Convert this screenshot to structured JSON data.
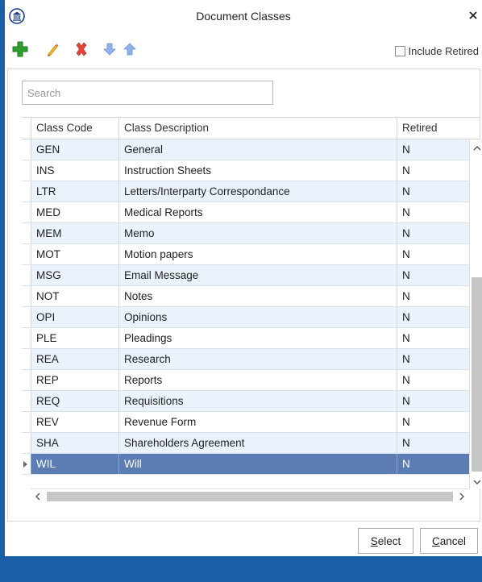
{
  "window": {
    "title": "Document Classes"
  },
  "toolbar": {
    "add_icon": "plus-icon",
    "edit_icon": "pencil-icon",
    "delete_icon": "x-icon",
    "down_icon": "arrow-down-icon",
    "up_icon": "arrow-up-icon",
    "include_retired_label": "Include Retired",
    "include_retired_checked": false
  },
  "search": {
    "placeholder": "Search",
    "value": ""
  },
  "grid": {
    "columns": [
      "Class Code",
      "Class Description",
      "Retired"
    ],
    "rows": [
      {
        "code": "GEN",
        "description": "General",
        "retired": "N"
      },
      {
        "code": "INS",
        "description": "Instruction Sheets",
        "retired": "N"
      },
      {
        "code": "LTR",
        "description": "Letters/Interparty Correspondance",
        "retired": "N"
      },
      {
        "code": "MED",
        "description": "Medical Reports",
        "retired": "N"
      },
      {
        "code": "MEM",
        "description": "Memo",
        "retired": "N"
      },
      {
        "code": "MOT",
        "description": "Motion papers",
        "retired": "N"
      },
      {
        "code": "MSG",
        "description": "Email Message",
        "retired": "N"
      },
      {
        "code": "NOT",
        "description": "Notes",
        "retired": "N"
      },
      {
        "code": "OPI",
        "description": "Opinions",
        "retired": "N"
      },
      {
        "code": "PLE",
        "description": "Pleadings",
        "retired": "N"
      },
      {
        "code": "REA",
        "description": "Research",
        "retired": "N"
      },
      {
        "code": "REP",
        "description": "Reports",
        "retired": "N"
      },
      {
        "code": "REQ",
        "description": "Requisitions",
        "retired": "N"
      },
      {
        "code": "REV",
        "description": "Revenue Form",
        "retired": "N"
      },
      {
        "code": "SHA",
        "description": "Shareholders Agreement",
        "retired": "N"
      },
      {
        "code": "WIL",
        "description": "Will",
        "retired": "N"
      }
    ],
    "selected_index": 15
  },
  "buttons": {
    "select_label": "Select",
    "select_mnemonic": "S",
    "select_rest": "elect",
    "cancel_label": "Cancel",
    "cancel_mnemonic": "C",
    "cancel_rest": "ancel"
  },
  "colors": {
    "selection": "#5b7db3",
    "alt_row": "#eaf2fb",
    "frame": "#1a5fa6"
  }
}
